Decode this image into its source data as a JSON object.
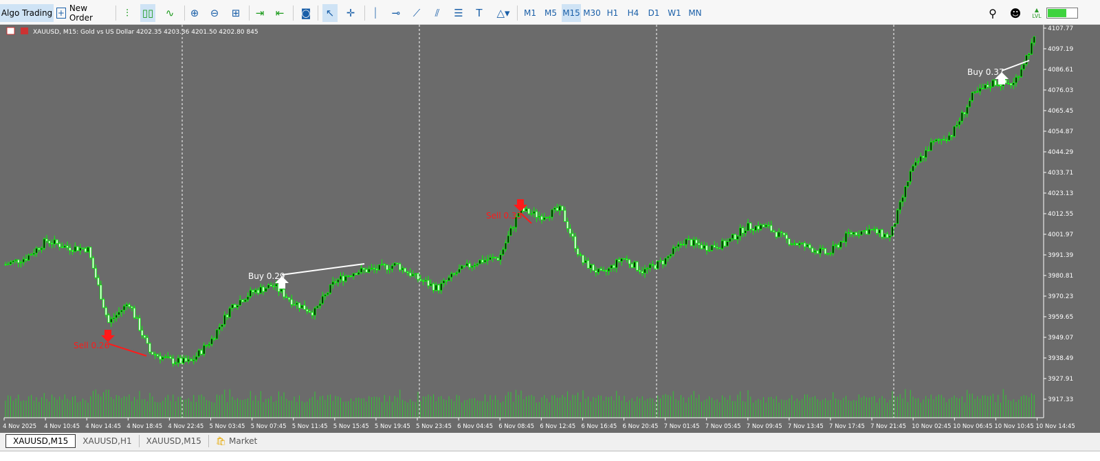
{
  "toolbar": {
    "algo_trading": "Algo Trading",
    "new_order": "New Order",
    "icons": [
      "bar-chart-icon",
      "candlestick-icon",
      "line-chart-icon",
      "zoom-in-icon",
      "zoom-out-icon",
      "tile-windows-icon",
      "chart-shift-icon",
      "autoscroll-icon",
      "screenshot-icon",
      "cursor-icon",
      "crosshair-icon",
      "vertical-line-icon",
      "horizontal-line-icon",
      "trendline-icon",
      "equidistant-channel-icon",
      "fibonacci-icon",
      "text-icon",
      "shapes-icon"
    ],
    "timeframes": [
      "M1",
      "M5",
      "M15",
      "M30",
      "H1",
      "H4",
      "D1",
      "W1",
      "MN"
    ],
    "active_timeframe": "M15",
    "lvl": "LVL",
    "battery_level": 0.65
  },
  "chart": {
    "info": "XAUUSD, M15:  Gold vs US Dollar  4202.35 4203.36 4201.50 4202.80  845",
    "colors": {
      "background": "#6b6b6b",
      "bull": "#00ff00",
      "volume": "#33c533",
      "sell": "#ff1a1a",
      "buy": "#ffffff"
    },
    "trades": [
      {
        "label": "Sell 0.26",
        "side": "sell"
      },
      {
        "label": "Buy 0.29",
        "side": "buy"
      },
      {
        "label": "Sell 0.33",
        "side": "sell"
      },
      {
        "label": "Buy 0.37",
        "side": "buy"
      }
    ]
  },
  "chart_data": {
    "type": "candlestick",
    "symbol": "XAUUSD",
    "timeframe": "M15",
    "y_ticks": [
      "4107.77",
      "4097.19",
      "4086.61",
      "4076.03",
      "4065.45",
      "4054.87",
      "4044.29",
      "4033.71",
      "4023.13",
      "4012.55",
      "4001.97",
      "3991.39",
      "3980.81",
      "3970.23",
      "3959.65",
      "3949.07",
      "3938.49",
      "3927.91",
      "3917.33"
    ],
    "ylim": [
      3917.33,
      4107.77
    ],
    "x_ticks": [
      "4 Nov 2025",
      "4 Nov 10:45",
      "4 Nov 14:45",
      "4 Nov 18:45",
      "4 Nov 22:45",
      "5 Nov 03:45",
      "5 Nov 07:45",
      "5 Nov 11:45",
      "5 Nov 15:45",
      "5 Nov 19:45",
      "5 Nov 23:45",
      "6 Nov 04:45",
      "6 Nov 08:45",
      "6 Nov 12:45",
      "6 Nov 16:45",
      "6 Nov 20:45",
      "7 Nov 01:45",
      "7 Nov 05:45",
      "7 Nov 09:45",
      "7 Nov 13:45",
      "7 Nov 17:45",
      "7 Nov 21:45",
      "10 Nov 02:45",
      "10 Nov 06:45",
      "10 Nov 10:45",
      "10 Nov 14:45"
    ],
    "price_path": [
      3986.45,
      3989.97,
      3998.79,
      3995.27,
      3994.56,
      3956.47,
      3967.05,
      3941.66,
      3937.07,
      3936.37,
      3947.65,
      3965.29,
      3972.34,
      3975.87,
      3967.05,
      3961.76,
      3977.63,
      3982.92,
      3983.98,
      3986.45,
      3979.39,
      3974.1,
      3982.92,
      3988.21,
      3989.97,
      4014.66,
      4011.14,
      4014.66,
      3988.21,
      3981.16,
      3989.97,
      3982.92,
      3988.21,
      3998.79,
      3995.27,
      3997.03,
      4005.85,
      4005.85,
      3998.79,
      3995.27,
      3991.74,
      4002.32,
      4004.08,
      4000.56,
      4034.06,
      4048.17,
      4053.46,
      4072.85,
      4079.91,
      4079.2,
      4101.77
    ]
  },
  "tabs": [
    "XAUUSD,M15",
    "XAUUSD,H1",
    "XAUUSD,M15",
    "Market"
  ]
}
